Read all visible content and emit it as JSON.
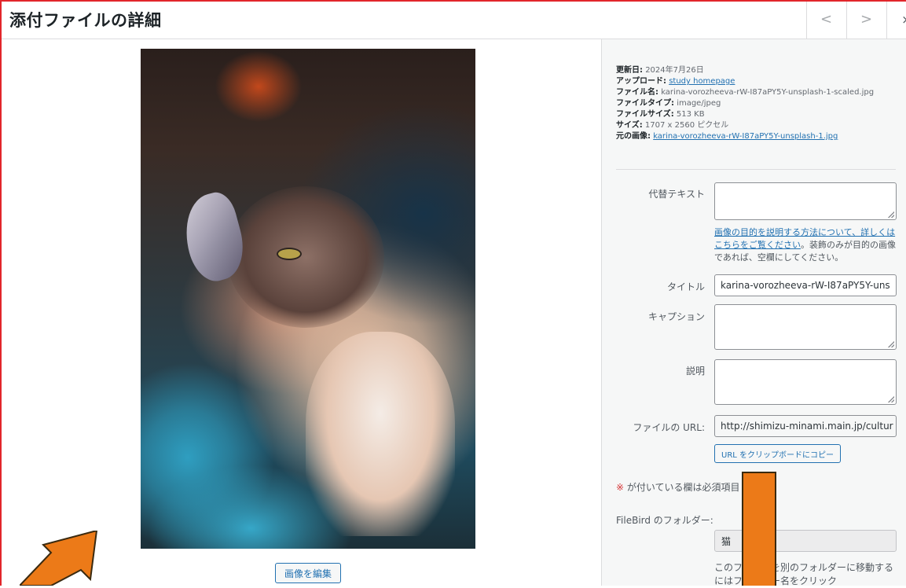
{
  "header": {
    "title": "添付ファイルの詳細",
    "prev_glyph": "<",
    "next_glyph": ">",
    "close_glyph": "×"
  },
  "image_pane": {
    "edit_button": "画像を編集"
  },
  "details": {
    "updated_label": "更新日:",
    "updated_value": "2024年7月26日",
    "uploaded_label": "アップロード:",
    "uploaded_value": "study homepage",
    "filename_label": "ファイル名:",
    "filename_value": "karina-vorozheeva-rW-I87aPY5Y-unsplash-1-scaled.jpg",
    "filetype_label": "ファイルタイプ:",
    "filetype_value": "image/jpeg",
    "filesize_label": "ファイルサイズ:",
    "filesize_value": "513 KB",
    "dimensions_label": "サイズ:",
    "dimensions_value": "1707 x 2560 ピクセル",
    "original_label": "元の画像:",
    "original_value": "karina-vorozheeva-rW-I87aPY5Y-unsplash-1.jpg"
  },
  "form": {
    "alt_label": "代替テキスト",
    "alt_value": "",
    "alt_help_link": "画像の目的を説明する方法について、詳しくはこちらをご覧ください",
    "alt_help_text": "。装飾のみが目的の画像であれば、空欄にしてください。",
    "title_label": "タイトル",
    "title_value": "karina-vorozheeva-rW-I87aPY5Y-uns",
    "caption_label": "キャプション",
    "caption_value": "",
    "description_label": "説明",
    "description_value": "",
    "url_label": "ファイルの URL:",
    "url_value": "http://shimizu-minami.main.jp/cultur",
    "copy_button": "URL をクリップボードにコピー",
    "required_star": "※",
    "required_note": " が付いている欄は必須項目",
    "filebird_label": "FileBird のフォルダー:",
    "filebird_value": "猫",
    "filebird_help": "このファイルを別のフォルダーに移動するにはフォルダー名をクリック"
  },
  "colors": {
    "accent": "#2271b1",
    "border_highlight": "#e2262b",
    "annotation_arrow": "#ec7a18"
  }
}
